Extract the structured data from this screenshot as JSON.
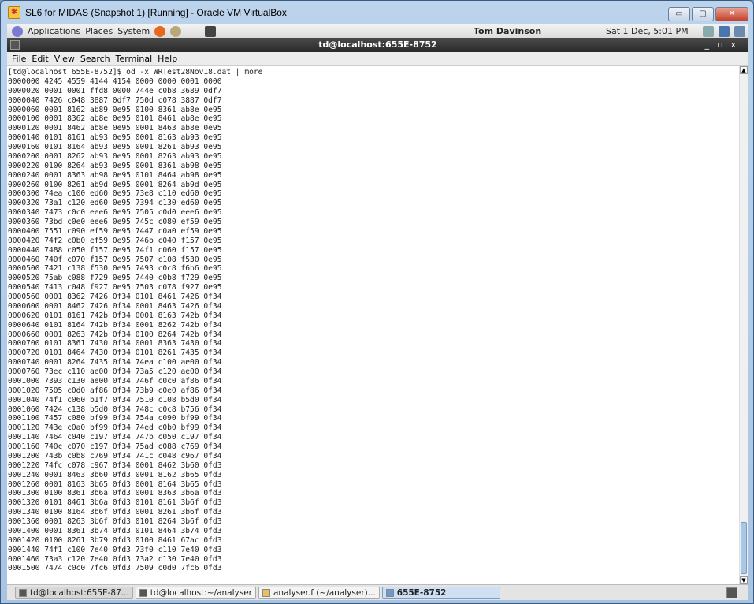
{
  "window": {
    "title": "SL6 for MIDAS (Snapshot 1) [Running] - Oracle VM VirtualBox",
    "minimize": "▭",
    "restore": "▢",
    "close": "✕"
  },
  "panel": {
    "menus": [
      "Applications",
      "Places",
      "System"
    ],
    "user": "Tom Davinson",
    "clock": "Sat  1 Dec,  5:01 PM"
  },
  "terminal": {
    "title": "td@localhost:655E-8752",
    "controls": "_▫x",
    "menu": [
      "File",
      "Edit",
      "View",
      "Search",
      "Terminal",
      "Help"
    ],
    "lines": [
      "[td@localhost 655E-8752]$ od -x WRTest28Nov18.dat | more",
      "0000000 4245 4559 4144 4154 0000 0000 0001 0000",
      "0000020 0001 0001 ffd8 0000 744e c0b8 3689 0df7",
      "0000040 7426 c048 3887 0df7 750d c078 3887 0df7",
      "0000060 0001 8162 ab89 0e95 0100 8361 ab8e 0e95",
      "0000100 0001 8362 ab8e 0e95 0101 8461 ab8e 0e95",
      "0000120 0001 8462 ab8e 0e95 0001 8463 ab8e 0e95",
      "0000140 0101 8161 ab93 0e95 0001 8163 ab93 0e95",
      "0000160 0101 8164 ab93 0e95 0001 8261 ab93 0e95",
      "0000200 0001 8262 ab93 0e95 0001 8263 ab93 0e95",
      "0000220 0100 8264 ab93 0e95 0001 8361 ab98 0e95",
      "0000240 0001 8363 ab98 0e95 0101 8464 ab98 0e95",
      "0000260 0100 8261 ab9d 0e95 0001 8264 ab9d 0e95",
      "0000300 74ea c100 ed60 0e95 73e8 c110 ed60 0e95",
      "0000320 73a1 c120 ed60 0e95 7394 c130 ed60 0e95",
      "0000340 7473 c0c0 eee6 0e95 7505 c0d0 eee6 0e95",
      "0000360 73bd c0e0 eee6 0e95 745c c080 ef59 0e95",
      "0000400 7551 c090 ef59 0e95 7447 c0a0 ef59 0e95",
      "0000420 74f2 c0b0 ef59 0e95 746b c040 f157 0e95",
      "0000440 7488 c050 f157 0e95 74f1 c060 f157 0e95",
      "0000460 740f c070 f157 0e95 7507 c108 f530 0e95",
      "0000500 7421 c138 f530 0e95 7493 c0c8 f6b6 0e95",
      "0000520 75ab c088 f729 0e95 7440 c0b8 f729 0e95",
      "0000540 7413 c048 f927 0e95 7503 c078 f927 0e95",
      "0000560 0001 8362 7426 0f34 0101 8461 7426 0f34",
      "0000600 0001 8462 7426 0f34 0001 8463 7426 0f34",
      "0000620 0101 8161 742b 0f34 0001 8163 742b 0f34",
      "0000640 0101 8164 742b 0f34 0001 8262 742b 0f34",
      "0000660 0001 8263 742b 0f34 0100 8264 742b 0f34",
      "0000700 0101 8361 7430 0f34 0001 8363 7430 0f34",
      "0000720 0101 8464 7430 0f34 0101 8261 7435 0f34",
      "0000740 0001 8264 7435 0f34 74ea c100 ae00 0f34",
      "0000760 73ec c110 ae00 0f34 73a5 c120 ae00 0f34",
      "0001000 7393 c130 ae00 0f34 746f c0c0 af86 0f34",
      "0001020 7505 c0d0 af86 0f34 73b9 c0e0 af86 0f34",
      "0001040 74f1 c060 b1f7 0f34 7510 c108 b5d0 0f34",
      "0001060 7424 c138 b5d0 0f34 748c c0c8 b756 0f34",
      "0001100 7457 c080 bf99 0f34 754a c090 bf99 0f34",
      "0001120 743e c0a0 bf99 0f34 74ed c0b0 bf99 0f34",
      "0001140 7464 c040 c197 0f34 747b c050 c197 0f34",
      "0001160 740c c070 c197 0f34 75ad c088 c769 0f34",
      "0001200 743b c0b8 c769 0f34 741c c048 c967 0f34",
      "0001220 74fc c078 c967 0f34 0001 8462 3b60 0fd3",
      "0001240 0001 8463 3b60 0fd3 0001 8162 3b65 0fd3",
      "0001260 0001 8163 3b65 0fd3 0001 8164 3b65 0fd3",
      "0001300 0100 8361 3b6a 0fd3 0001 8363 3b6a 0fd3",
      "0001320 0101 8461 3b6a 0fd3 0101 8161 3b6f 0fd3",
      "0001340 0100 8164 3b6f 0fd3 0001 8261 3b6f 0fd3",
      "0001360 0001 8263 3b6f 0fd3 0101 8264 3b6f 0fd3",
      "0001400 0001 8361 3b74 0fd3 0101 8464 3b74 0fd3",
      "0001420 0100 8261 3b79 0fd3 0100 8461 67ac 0fd3",
      "0001440 74f1 c100 7e40 0fd3 73f0 c110 7e40 0fd3",
      "0001460 73a3 c120 7e40 0fd3 73a2 c130 7e40 0fd3",
      "0001500 7474 c0c0 7fc6 0fd3 7509 c0d0 7fc6 0fd3"
    ],
    "scroll_position_percent": 100
  },
  "taskbar": {
    "tasks": [
      "td@localhost:655E-87...",
      "td@localhost:~/analyser",
      "analyser.f (~/analyser)...",
      "655E-8752"
    ]
  }
}
